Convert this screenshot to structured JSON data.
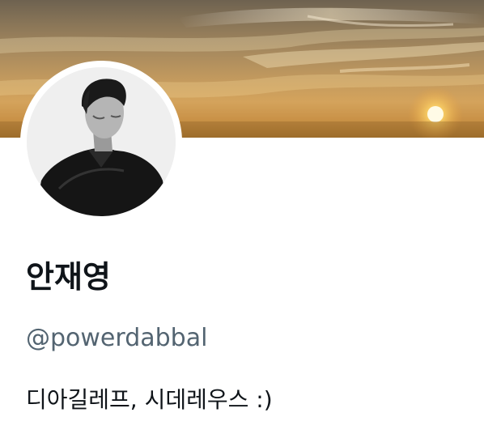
{
  "profile": {
    "display_name": "안재영",
    "handle": "@powerdabbal",
    "bio": "디아길레프, 시데레우스 :)",
    "banner_image": "sunset-sky",
    "avatar_image": "man-in-black-shirt"
  },
  "colors": {
    "name_text": "#0f1419",
    "handle_text": "#536471",
    "background": "#ffffff"
  }
}
